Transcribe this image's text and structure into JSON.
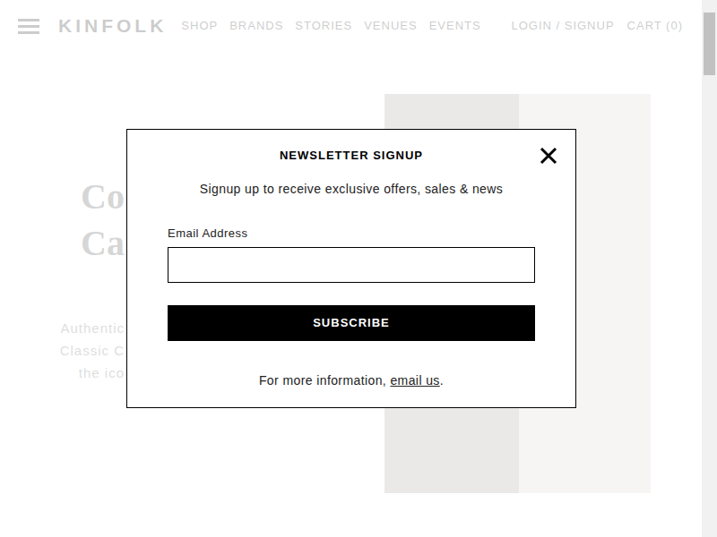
{
  "header": {
    "logo": "KINFOLK",
    "nav": [
      "SHOP",
      "BRANDS",
      "STORIES",
      "VENUES",
      "EVENTS"
    ],
    "login": "LOGIN / SIGNUP",
    "cart": "CART (0)"
  },
  "background": {
    "heading_lines": [
      "Co",
      "Ca"
    ],
    "body_lines": [
      "Authentic",
      "Classic C",
      "the ico"
    ]
  },
  "modal": {
    "title": "NEWSLETTER SIGNUP",
    "subtitle": "Signup up to receive exclusive offers, sales & news",
    "email_label": "Email Address",
    "button": "SUBSCRIBE",
    "footer_text": "For more information, ",
    "footer_link": "email us",
    "footer_end": "."
  }
}
